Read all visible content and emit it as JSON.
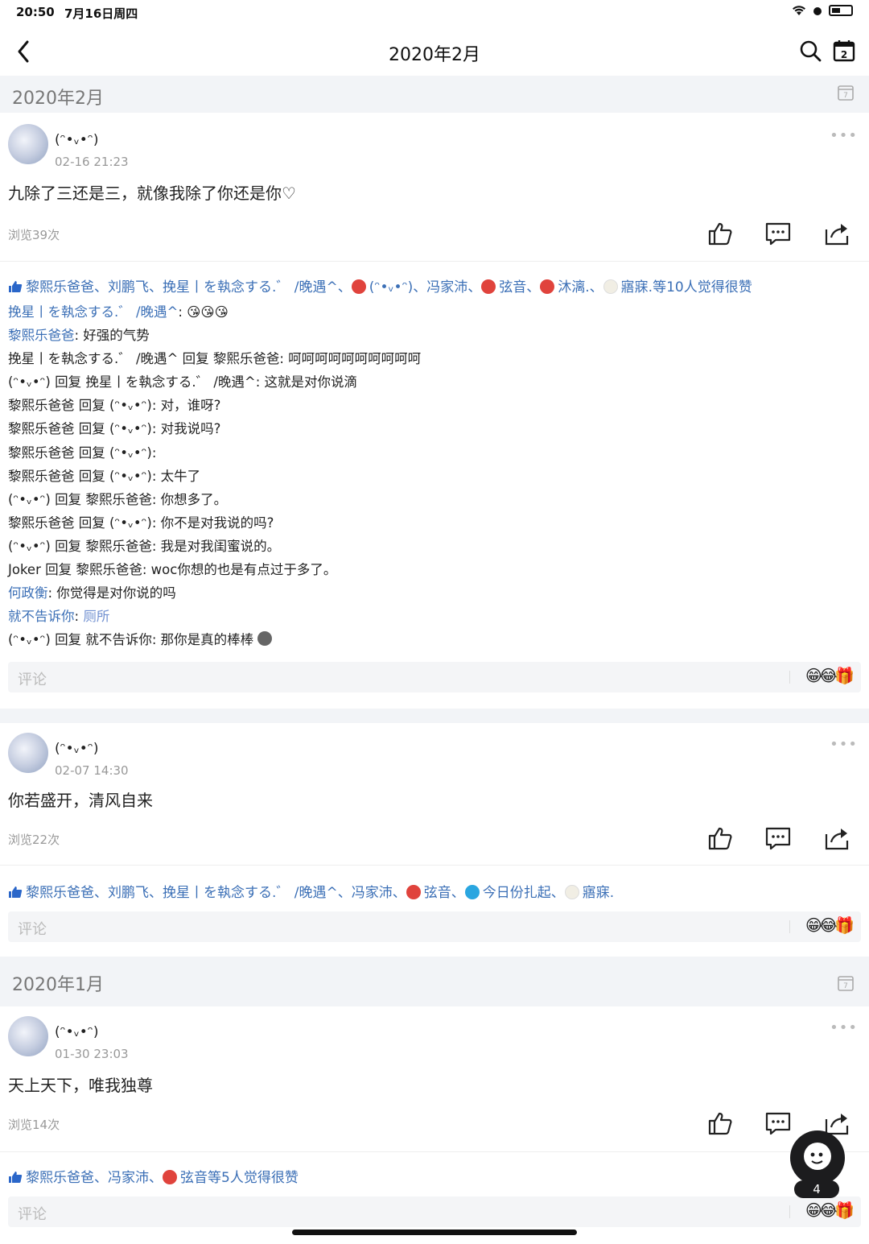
{
  "status_bar": {
    "time": "20:50",
    "date": "7月16日周四"
  },
  "nav": {
    "title": "2020年2月"
  },
  "months": [
    {
      "label": "2020年2月"
    },
    {
      "label": "2020年1月"
    }
  ],
  "posts": [
    {
      "user": "(ᵔ•ᵥ•ᵔ)",
      "time": "02-16 21:23",
      "text": "九除了三还是三，就像我除了你还是你♡",
      "views": "浏览39次",
      "likes": {
        "p1": "黎熙乐爸爸、刘鹏飞、挽星丨を執念する.゛ /晚遇^、",
        "p2": "(ᵔ•ᵥ•ᵔ)、冯家沛、",
        "p3": "弦音、",
        "p4": "沐漓.、",
        "p5": "寤寐.等10人觉得很赞"
      },
      "comments": [
        {
          "name": "挽星丨を執念する.゛ /晚遇^",
          "text": ": 😘😘😘"
        },
        {
          "name": "黎熙乐爸爸",
          "text": ": 好强的气势"
        },
        {
          "name": "挽星丨を執念する.゛ /晚遇^ 回复 黎熙乐爸爸",
          "text": ": 呵呵呵呵呵呵呵呵呵呵"
        },
        {
          "name": "(ᵔ•ᵥ•ᵔ) 回复 挽星丨を執念する.゛ /晚遇^",
          "text": ": 这就是对你说滴"
        },
        {
          "name": "黎熙乐爸爸 回复 (ᵔ•ᵥ•ᵔ)",
          "text": ": 对，谁呀?"
        },
        {
          "name": "黎熙乐爸爸 回复 (ᵔ•ᵥ•ᵔ)",
          "text": ": 对我说吗?"
        },
        {
          "name": "黎熙乐爸爸 回复 (ᵔ•ᵥ•ᵔ)",
          "text": ":"
        },
        {
          "name": "黎熙乐爸爸 回复 (ᵔ•ᵥ•ᵔ)",
          "text": ": 太牛了"
        },
        {
          "name": "(ᵔ•ᵥ•ᵔ) 回复 黎熙乐爸爸",
          "text": ": 你想多了。"
        },
        {
          "name": "黎熙乐爸爸 回复 (ᵔ•ᵥ•ᵔ)",
          "text": ": 你不是对我说的吗?"
        },
        {
          "name": "(ᵔ•ᵥ•ᵔ) 回复 黎熙乐爸爸",
          "text": ": 我是对我闺蜜说的。"
        },
        {
          "name": "Joker 回复 黎熙乐爸爸",
          "text": ": woc你想的也是有点过于多了。"
        },
        {
          "name": "何政衡",
          "text": ": 你觉得是对你说的吗"
        },
        {
          "name": "就不告诉你",
          "text": ": ",
          "link": "厕所"
        },
        {
          "name": "(ᵔ•ᵥ•ᵔ) 回复 就不告诉你",
          "text": ": 那你是真的棒棒"
        }
      ],
      "comment_placeholder": "评论",
      "emoji": "😁😂🎁"
    },
    {
      "user": "(ᵔ•ᵥ•ᵔ)",
      "time": "02-07 14:30",
      "text": "你若盛开，清风自来",
      "views": "浏览22次",
      "likes": {
        "p1": "黎熙乐爸爸、刘鹏飞、挽星丨を執念する.゛ /晚遇^、冯家沛、",
        "p2": "弦音、",
        "p3": "今日份扎起、",
        "p4": "寤寐."
      },
      "comment_placeholder": "评论",
      "emoji": "😁😂🎁"
    },
    {
      "user": "(ᵔ•ᵥ•ᵔ)",
      "time": "01-30 23:03",
      "text": "天上天下，唯我独尊",
      "views": "浏览14次",
      "likes": {
        "p1": "黎熙乐爸爸、冯家沛、",
        "p2": "弦音等5人觉得很赞"
      },
      "comment_placeholder": "评论",
      "emoji": "😁😂🎁"
    }
  ],
  "float_badge": "4",
  "colors": {
    "link_blue": "#3b6fb6",
    "like_blue": "#2a66c9",
    "red_avatar": "#e0433c",
    "cyan_avatar": "#2aa6e0"
  }
}
